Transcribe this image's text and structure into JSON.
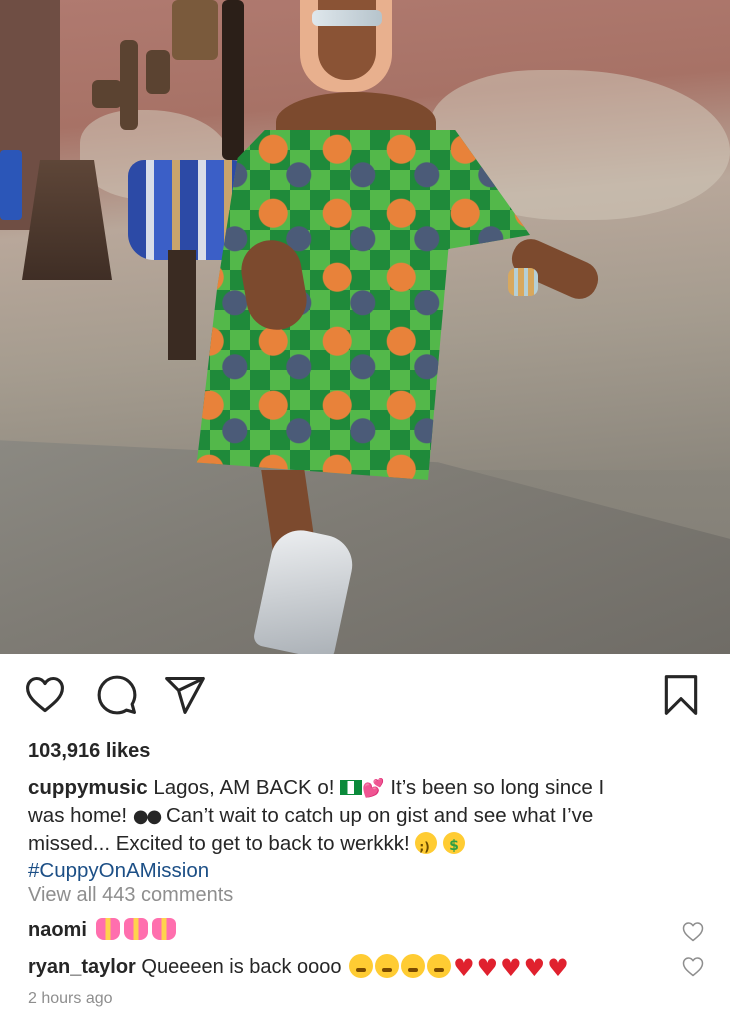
{
  "post": {
    "likes_text": "103,916 likes",
    "caption": {
      "username": "cuppymusic",
      "line1_a": "Lagos, AM BACK o!",
      "line1_b": "It’s been so long since I",
      "line2_a": "was home!",
      "line2_b": "Can’t wait to catch up on gist and see what I’ve",
      "line3": "missed... Excited to get to back to werkkk!",
      "hashtag": "#CuppyOnAMission"
    },
    "view_comments": "View all 443 comments",
    "comments": [
      {
        "username": "naomi",
        "text": "",
        "emoji": [
          "gift-heart",
          "gift-heart",
          "gift-heart"
        ]
      },
      {
        "username": "ryan_taylor",
        "text": "Queeeen is back oooo",
        "emoji": [
          "tired-face",
          "tired-face",
          "tired-face",
          "tired-face",
          "red-heart",
          "red-heart",
          "red-heart",
          "red-heart",
          "red-heart"
        ]
      }
    ],
    "timestamp": "2 hours ago"
  },
  "icons": {
    "like": "heart-outline-icon",
    "comment": "comment-bubble-icon",
    "share": "paper-plane-icon",
    "save": "bookmark-icon"
  },
  "colors": {
    "text": "#262626",
    "muted": "#8e8e8e",
    "hashtag": "#1c4f86"
  }
}
